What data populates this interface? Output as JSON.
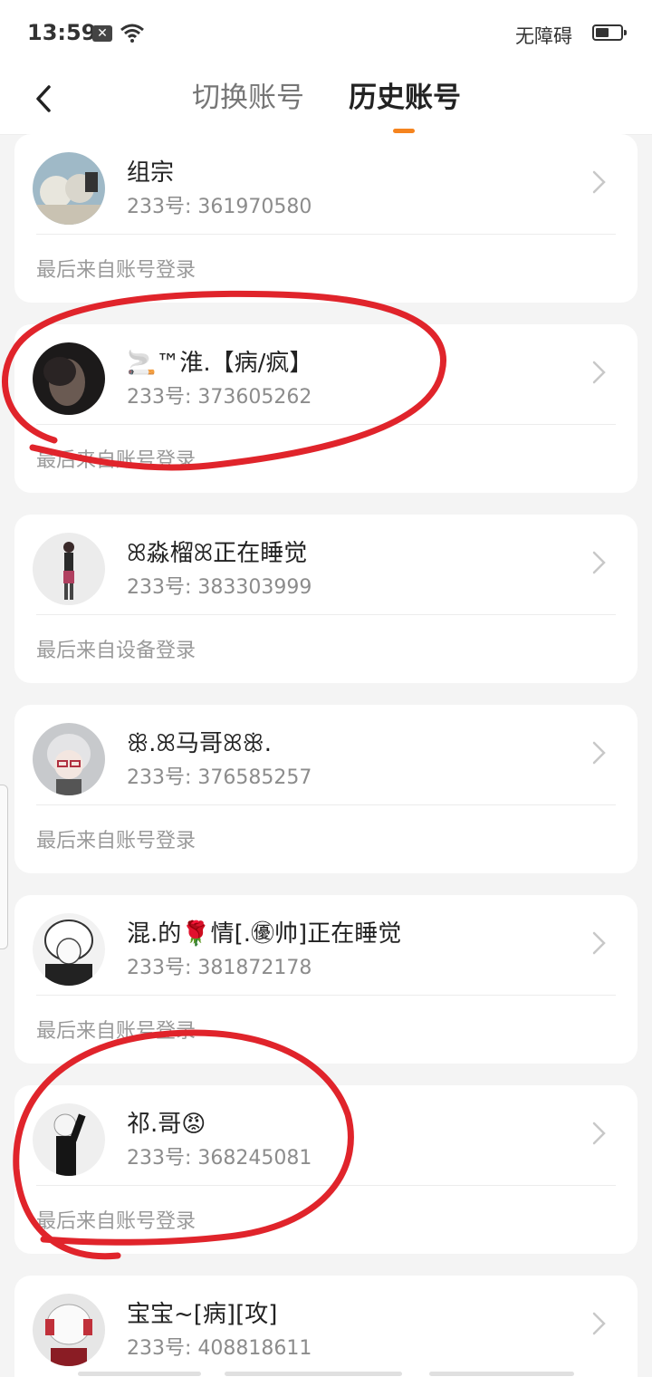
{
  "status_bar": {
    "time": "13:59",
    "accessibility_label": "无障碍"
  },
  "header": {
    "tabs": [
      {
        "label": "切换账号"
      },
      {
        "label": "历史账号"
      }
    ]
  },
  "accounts": [
    {
      "name": "组宗",
      "uid": "233号: 361970580",
      "footer": "最后来自账号登录"
    },
    {
      "name": "🚬™淮.【病/疯】",
      "uid": "233号: 373605262",
      "footer": "最后来自账号登录"
    },
    {
      "name": "ꕤ淼榴ꕤ正在睡觉",
      "uid": "233号: 383303999",
      "footer": "最后来自设备登录"
    },
    {
      "name": "ꕥ.ꕤ马哥ꕤꕥ.",
      "uid": "233号: 376585257",
      "footer": "最后来自账号登录"
    },
    {
      "name": "混.的🌹情[.㊝帅]正在睡觉",
      "uid": "233号: 381872178",
      "footer": "最后来自账号登录"
    },
    {
      "name": "祁.哥😡",
      "uid": "233号: 368245081",
      "footer": "最后来自账号登录"
    },
    {
      "name": "宝宝~[病][攻]",
      "uid": "233号: 408818611",
      "footer": ""
    }
  ],
  "colors": {
    "accent": "#f5841f",
    "annotation": "#e0242b"
  }
}
